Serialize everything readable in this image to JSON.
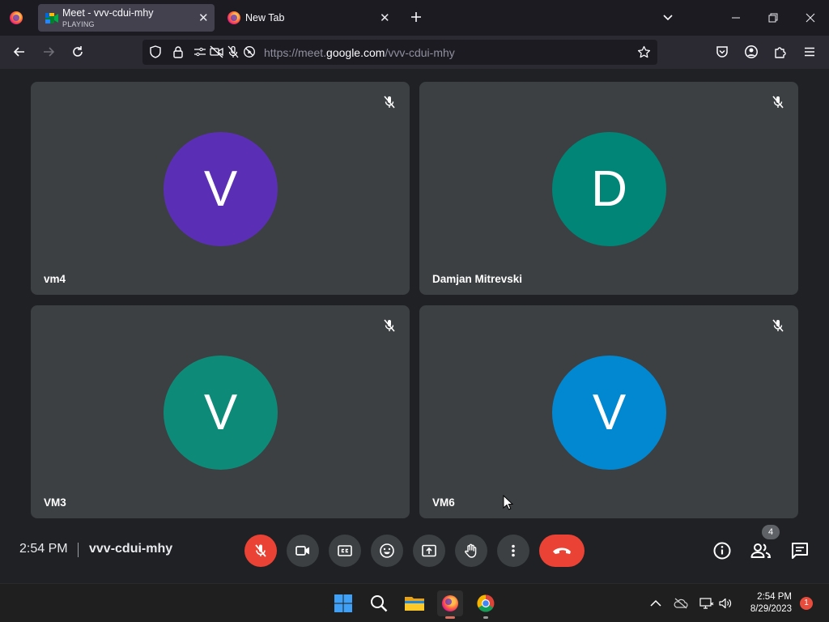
{
  "browser": {
    "tabs": [
      {
        "title": "Meet - vvv-cdui-mhy",
        "subtitle": "PLAYING",
        "active": true,
        "favicon": "meet-icon"
      },
      {
        "title": "New Tab",
        "active": false,
        "favicon": "firefox-icon"
      }
    ],
    "new_tab_icon": "plus-icon",
    "url": {
      "scheme": "https://meet.",
      "host": "google.com",
      "path": "/vvv-cdui-mhy"
    },
    "toolbar_icons": [
      "back-icon",
      "forward-icon",
      "reload-icon",
      "tracking-shield-icon",
      "lock-icon",
      "permissions-icon",
      "camera-blocked-icon",
      "mic-blocked-icon",
      "autoplay-blocked-icon",
      "bookmark-star-icon",
      "pocket-icon",
      "account-icon",
      "extensions-icon",
      "menu-icon"
    ]
  },
  "meet": {
    "participants": [
      {
        "name": "vm4",
        "initial": "V",
        "color": "#5b2fb5"
      },
      {
        "name": "Damjan Mitrevski",
        "initial": "D",
        "color": "#008577"
      },
      {
        "name": "VM3",
        "initial": "V",
        "color": "#0d8b78"
      },
      {
        "name": "VM6",
        "initial": "V",
        "color": "#0288d1"
      }
    ],
    "time": "2:54 PM",
    "meeting_code": "vvv-cdui-mhy",
    "participant_count": "4",
    "controls": [
      "mic-off-icon",
      "camera-icon",
      "captions-icon",
      "emoji-icon",
      "present-icon",
      "raise-hand-icon",
      "more-options-icon",
      "hang-up-icon"
    ],
    "side_controls": [
      "info-icon",
      "people-icon",
      "chat-icon"
    ],
    "colors": {
      "background": "#202124",
      "tile": "#3c4043",
      "danger": "#ea4335"
    }
  },
  "taskbar": {
    "apps": [
      "windows-start-icon",
      "search-icon",
      "file-explorer-icon",
      "firefox-icon",
      "chrome-icon"
    ],
    "tray": [
      "chevron-up-icon",
      "onedrive-icon",
      "network-icon",
      "volume-icon"
    ],
    "time": "2:54 PM",
    "date": "8/29/2023",
    "notifications": "1"
  }
}
